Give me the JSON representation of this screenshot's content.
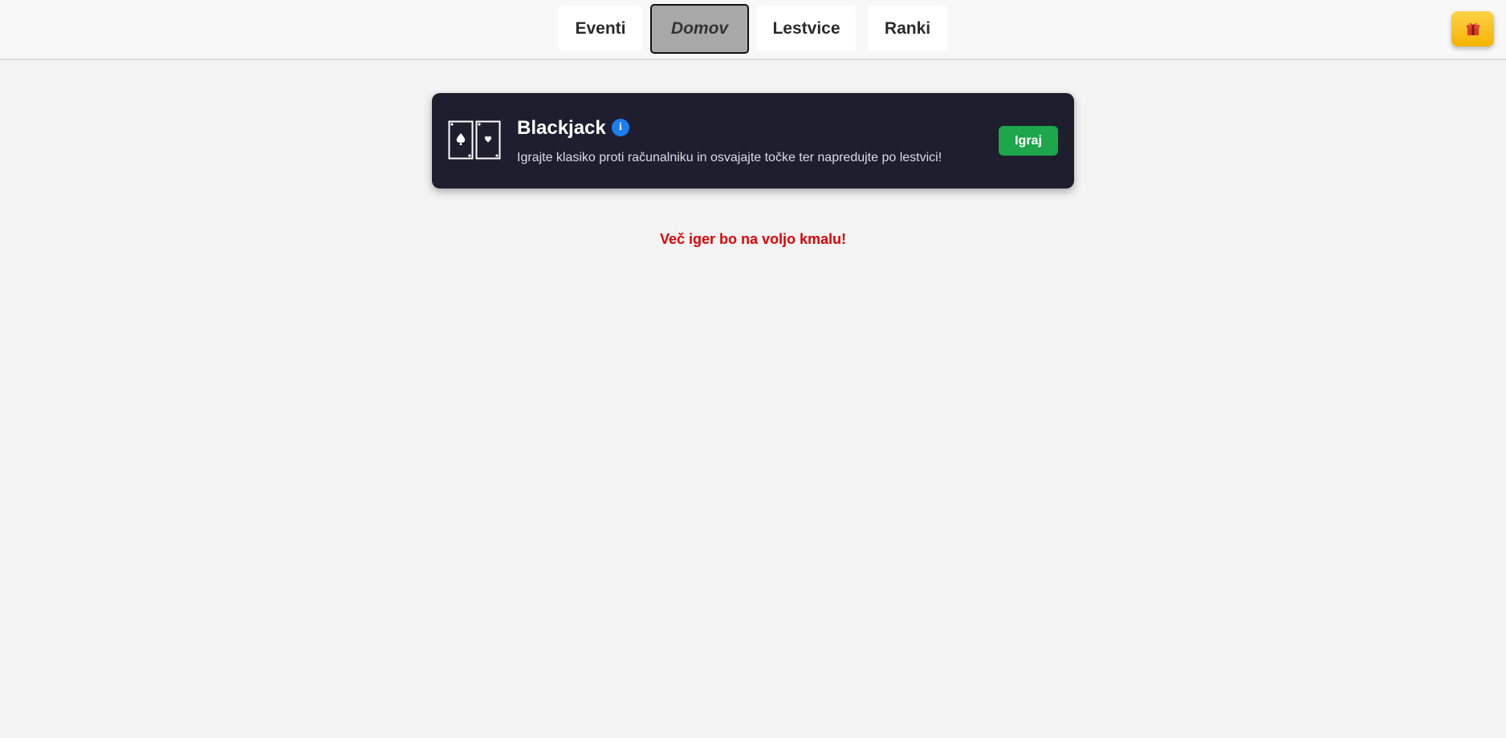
{
  "nav": {
    "items": [
      {
        "label": "Eventi",
        "active": false
      },
      {
        "label": "Domov",
        "active": true
      },
      {
        "label": "Lestvice",
        "active": false
      },
      {
        "label": "Ranki",
        "active": false
      }
    ],
    "gift_icon": "gift-icon"
  },
  "game": {
    "title": "Blackjack",
    "icon": "playing-cards-icon",
    "info_symbol": "i",
    "description": "Igrajte klasiko proti računalniku in osvajajte točke ter napredujte po lestvici!",
    "play_label": "Igraj",
    "card_color": "#1f1e2f",
    "play_color": "#1ea64a"
  },
  "notice": "Več iger bo na voljo kmalu!"
}
